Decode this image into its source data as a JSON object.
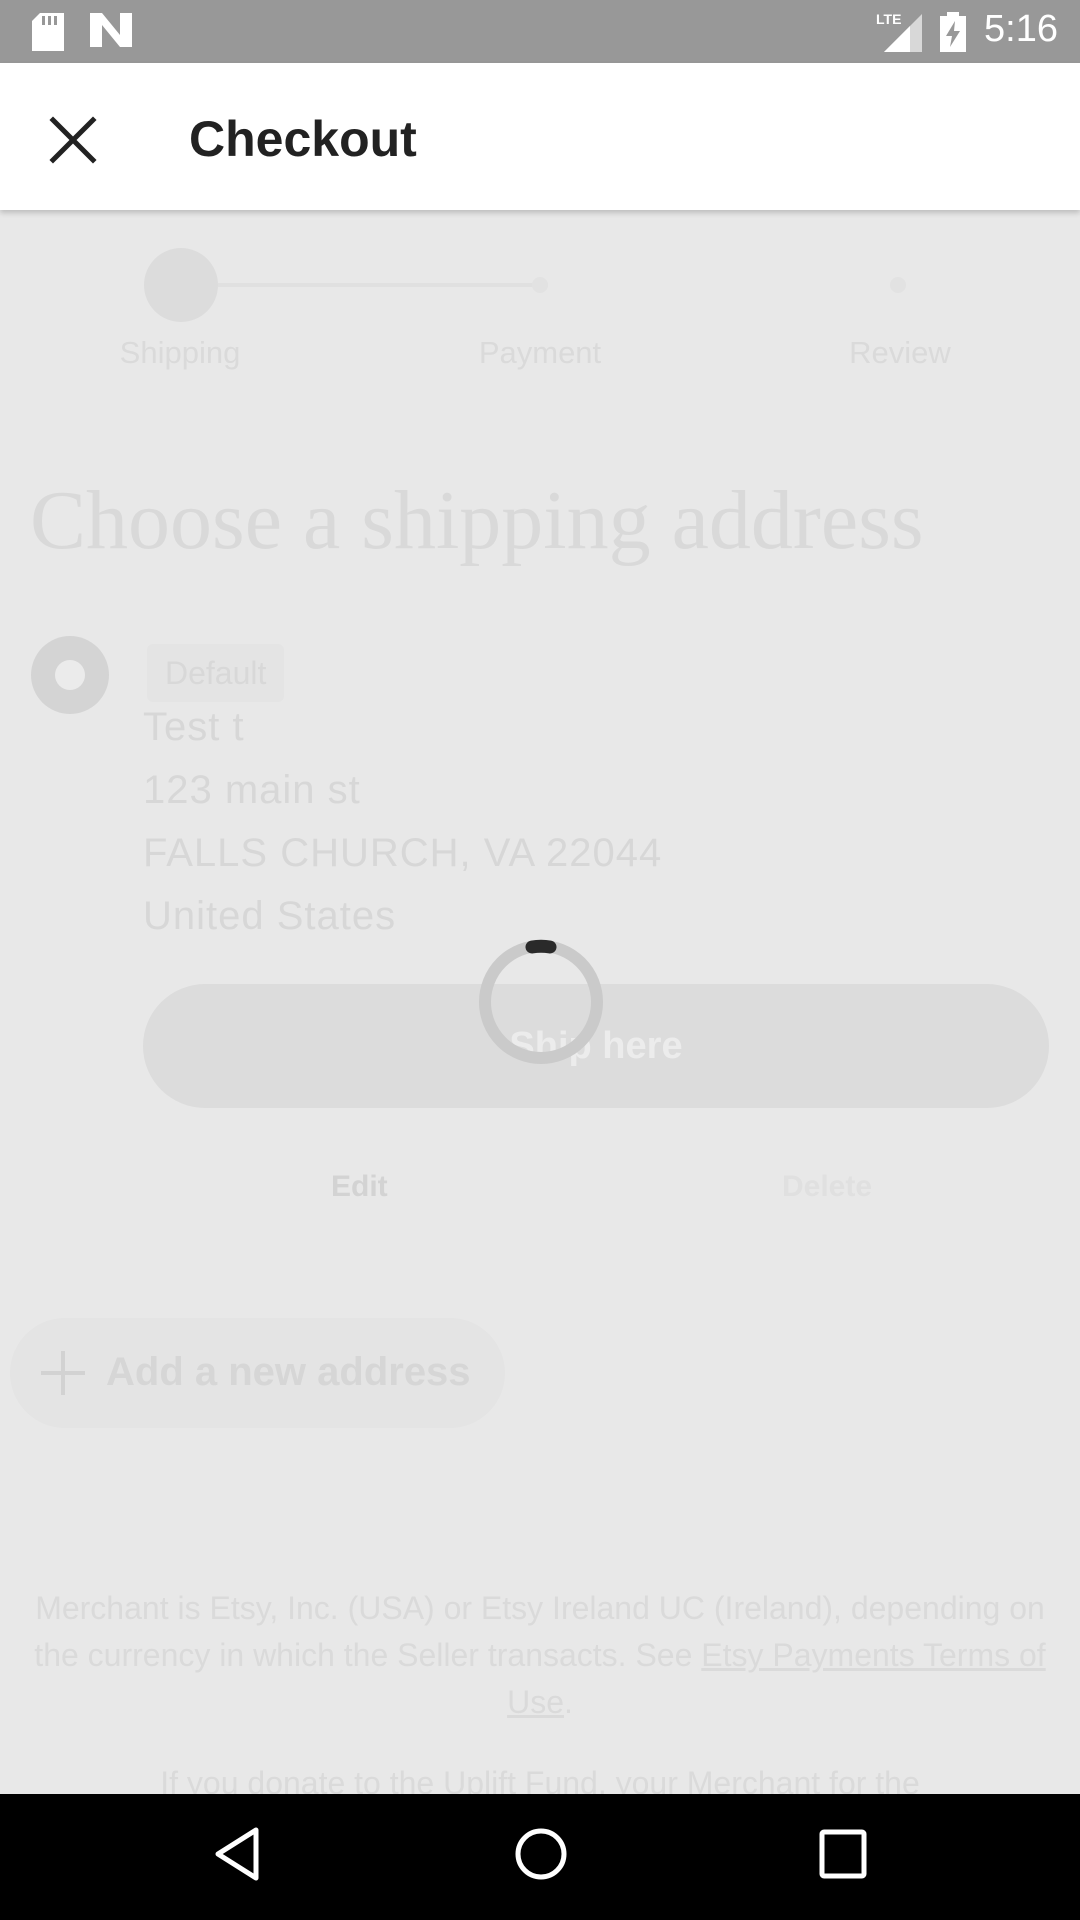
{
  "status_bar": {
    "time": "5:16",
    "network": "LTE",
    "icons": [
      "sd-card-icon",
      "n-logo-icon",
      "signal-lte-icon",
      "battery-charging-icon"
    ]
  },
  "app_bar": {
    "title": "Checkout",
    "close_icon": "close-icon"
  },
  "stepper": {
    "steps": [
      {
        "label": "Shipping",
        "active": true
      },
      {
        "label": "Payment",
        "active": false
      },
      {
        "label": "Review",
        "active": false
      }
    ]
  },
  "main": {
    "heading": "Choose a shipping address",
    "address": {
      "badge": "Default",
      "lines": [
        "Test t",
        "123 main st",
        "FALLS CHURCH, VA 22044",
        "United States"
      ],
      "ship_button": "Ship here",
      "edit_link": "Edit",
      "delete_link": "Delete"
    },
    "add_address": "Add a new address",
    "legal": {
      "text": "Merchant is Etsy, Inc. (USA) or Etsy Ireland UC (Ireland), depending on the currency in which the Seller transacts. See",
      "link": "Etsy Payments Terms of Use",
      "period": ".",
      "second": "If you donate to the Uplift Fund, your Merchant for the"
    }
  },
  "loading": true,
  "colors": {
    "scrim": "#e8e8e8",
    "status_bar": "#989898",
    "nav_bar": "#000000"
  }
}
